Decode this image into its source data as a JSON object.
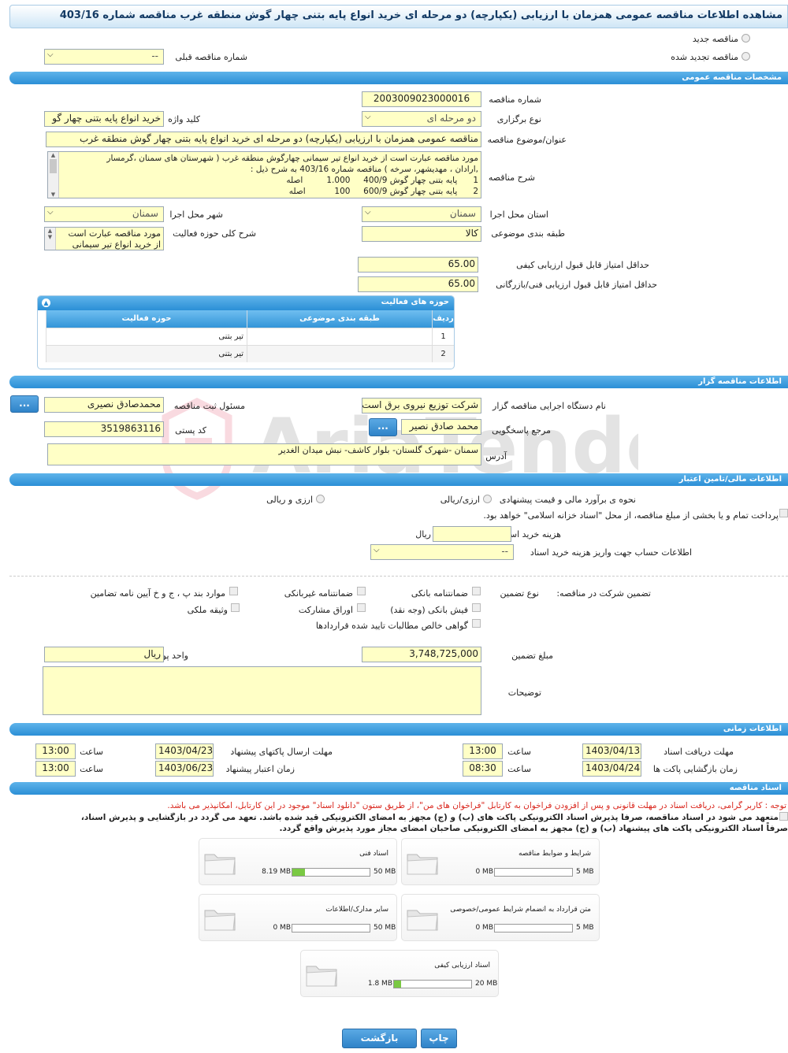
{
  "title": "مشاهده اطلاعات مناقصه عمومی همزمان با ارزیابی (یکپارچه) دو مرحله ای خرید انواع پایه بتنی چهار گوش منطقه غرب مناقصه شماره 403/16",
  "top": {
    "new_tender": "مناقصه جدید",
    "renewed_tender": "مناقصه تجدید شده",
    "prev_tender_label": "شماره مناقصه قبلی",
    "prev_tender_value": "--"
  },
  "sections": {
    "general": "مشخصات مناقصه عمومی",
    "organizer": "اطلاعات مناقصه گزار",
    "financial": "اطلاعات مالی/تامین اعتبار",
    "timing": "اطلاعات زمانی",
    "documents": "اسناد مناقصه"
  },
  "general": {
    "number_label": "شماره مناقصه",
    "number": "2003009023000016",
    "type_label": "نوع برگزاری",
    "type": "دو مرحله ای",
    "keyword_label": "کلید واژه",
    "keyword": "خرید انواع پایه بتنی چهار گو",
    "subject_label": "عنوان/موضوع مناقصه",
    "subject": "مناقصه عمومی همزمان با ارزیابی (یکپارچه) دو مرحله ای خرید انواع پایه بتنی چهار گوش منطقه غرب",
    "desc_label": "شرح مناقصه",
    "desc_lines": [
      "مورد مناقصه عبارت است از خرید انواع تیر سیمانی چهارگوش منطقه غرب ( شهرستان های سمنان ،گرمسار",
      ",ارادان ، مهدیشهر، سرخه ) مناقصه شماره 403/16 به شرح ذیل :",
      "1      پایه بتنی چهار گوش 400/9     1.000         اصله",
      "2      پایه بتنی چهار گوش 600/9     100           اصله"
    ],
    "province_label": "استان محل اجرا",
    "province": "سمنان",
    "city_label": "شهر محل اجرا",
    "city": "سمنان",
    "category_label": "طبقه بندی موضوعی",
    "category": "کالا",
    "scope_label": "شرح کلی حوزه فعالیت",
    "scope_lines": [
      "مورد مناقصه عبارت است",
      "از خرید انواع تیر سیمانی"
    ],
    "min_quality_label": "حداقل امتیاز قابل قبول ارزیابی کیفی",
    "min_quality": "65.00",
    "min_tech_label": "حداقل امتیاز قابل قبول ارزیابی فنی/بازرگانی",
    "min_tech": "65.00"
  },
  "activity_table": {
    "title": "حوزه های فعالیت",
    "headers": [
      "ردیف",
      "طبقه بندی موضوعی",
      "حوزه فعالیت"
    ],
    "rows": [
      {
        "num": "1",
        "category": "",
        "activity": "تیر بتنی"
      },
      {
        "num": "2",
        "category": "",
        "activity": "تیر بتنی"
      }
    ]
  },
  "organizer": {
    "org_label": "نام دستگاه اجرایی مناقصه گزار",
    "org": "شرکت توزیع نیروی برق است",
    "registrar_label": "مسئول ثبت مناقصه",
    "registrar": "محمدصادق نصیری",
    "ref_label": "مرجع پاسخگویی",
    "ref": "محمد صادق نصیر",
    "postal_label": "کد پستی",
    "postal": "3519863116",
    "address_label": "آدرس",
    "address": "سمنان -شهرک گلستان- بلوار کاشف- نبش میدان الغدیر",
    "more": "..."
  },
  "financial": {
    "estimate_label": "نحوه ی برآورد مالی و قیمت پیشنهادی",
    "rial_currency": "ارزی/ریالی",
    "currency_and_rial": "ارزی و ریالی",
    "treasury_text": "پرداخت تمام و یا بخشی از مبلغ مناقصه، از محل \"اسناد خزانه اسلامی\" خواهد بود.",
    "doc_cost_label": "هزینه خرید اسناد",
    "doc_cost_unit": "ریال",
    "account_label": "اطلاعات حساب جهت واریز هزینه خرید اسناد",
    "account_value": "--"
  },
  "guarantee": {
    "title": "تضمین شرکت در مناقصه:",
    "type_label": "نوع تضمین",
    "options": {
      "bank_guarantee": "ضمانتنامه بانکی",
      "non_bank": "ضمانتنامه غیربانکی",
      "regulation": "موارد بند پ ، ج و خ آیین نامه تضامین",
      "bank_receipt": "فیش بانکی (وجه نقد)",
      "bonds": "اوراق مشارکت",
      "property": "وثیقه ملکی",
      "claims": "گواهی خالص مطالبات تایید شده قراردادها"
    },
    "amount_label": "مبلغ تضمین",
    "amount": "3,748,725,000",
    "unit_label": "واحد پول",
    "unit": "ریال",
    "notes_label": "توضیحات",
    "notes": ""
  },
  "timing": {
    "doc_receive_label": "مهلت دریافت اسناد",
    "doc_receive_date": "1403/04/13",
    "doc_receive_time": "13:00",
    "send_label": "مهلت ارسال پاکتهای پیشنهاد",
    "send_date": "1403/04/23",
    "send_time": "13:00",
    "open_label": "زمان بازگشایی پاکت ها",
    "open_date": "1403/04/24",
    "open_time": "08:30",
    "validity_label": "زمان اعتبار پیشنهاد",
    "validity_date": "1403/06/23",
    "validity_time": "13:00",
    "time_label": "ساعت"
  },
  "documents": {
    "notice": "توجه : کاربر گرامی، دریافت اسناد در مهلت قانونی و پس از افزودن فراخوان به کارتابل \"فراخوان های من\"، از طریق ستون \"دانلود اسناد\" موجود در این کارتابل، امکانپذیر می باشد.",
    "commit_line1": "متعهد می شود در اسناد مناقصه، صرفاً پذیرش اسناد الکترونیکی پاکت های (ب) و (ج) مجهز به امضای الکترونیکی قید شده باشد. تعهد می گردد در بازگشایی و پذیرش اسناد،",
    "commit_line2": "صرفاً اسناد الکترونیکی پاکت های پیشنهاد (ب) و (ج) مجهز به امضای الکترونیکی صاحبان امضای مجاز مورد پذیرش واقع گردد.",
    "cards": [
      {
        "name": "شرایط و ضوابط مناقصه",
        "current": "0 MB",
        "max": "5 MB",
        "fill": 0
      },
      {
        "name": "اسناد فنی",
        "current": "8.19 MB",
        "max": "50 MB",
        "fill": 0.164
      },
      {
        "name": "متن قرارداد به انضمام شرایط عمومی/خصوصی",
        "current": "0 MB",
        "max": "5 MB",
        "fill": 0
      },
      {
        "name": "سایر مدارک/اطلاعات",
        "current": "0 MB",
        "max": "50 MB",
        "fill": 0
      },
      {
        "name": "اسناد ارزیابی کیفی",
        "current": "1.8 MB",
        "max": "20 MB",
        "fill": 0.09
      }
    ]
  },
  "buttons": {
    "print": "چاپ",
    "back": "بازگشت"
  },
  "colors": {
    "section_bar": "#2b8fd6",
    "field_bg": "#ffffc6",
    "notice_red": "#d9251c",
    "progress": "#7ac943"
  }
}
